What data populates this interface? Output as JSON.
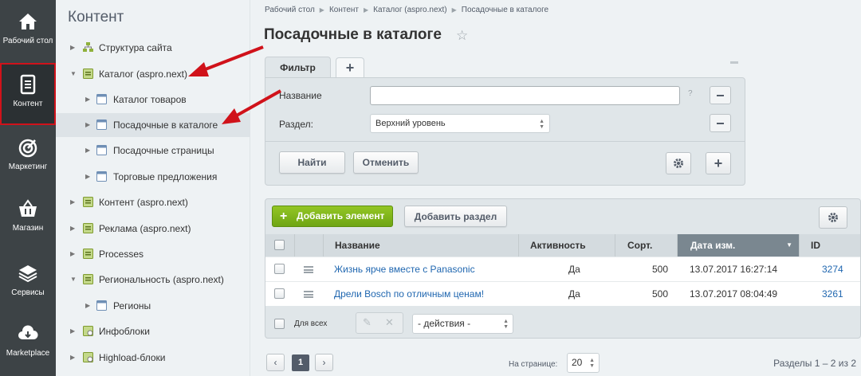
{
  "left_menu": [
    {
      "label": "Рабочий стол",
      "icon": "home-icon"
    },
    {
      "label": "Контент",
      "icon": "document-icon"
    },
    {
      "label": "Маркетинг",
      "icon": "target-icon"
    },
    {
      "label": "Магазин",
      "icon": "basket-icon"
    },
    {
      "label": "Сервисы",
      "icon": "layers-icon"
    },
    {
      "label": "Marketplace",
      "icon": "cloud-download-icon"
    }
  ],
  "tree": {
    "title": "Контент",
    "items": [
      {
        "label": "Структура сайта"
      },
      {
        "label": "Каталог (aspro.next)"
      },
      {
        "label": "Каталог товаров"
      },
      {
        "label": "Посадочные в каталоге"
      },
      {
        "label": "Посадочные страницы"
      },
      {
        "label": "Торговые предложения"
      },
      {
        "label": "Контент (aspro.next)"
      },
      {
        "label": "Реклама (aspro.next)"
      },
      {
        "label": "Processes"
      },
      {
        "label": "Региональность (aspro.next)"
      },
      {
        "label": "Регионы"
      },
      {
        "label": "Инфоблоки"
      },
      {
        "label": "Highload-блоки"
      }
    ]
  },
  "breadcrumbs": [
    "Рабочий стол",
    "Контент",
    "Каталог (aspro.next)",
    "Посадочные в каталоге"
  ],
  "page_title": "Посадочные в каталоге",
  "filter": {
    "tab_label": "Фильтр",
    "add_tab": "+",
    "name_label": "Название",
    "name_value": "",
    "help": "?",
    "section_label": "Раздел:",
    "section_value": "Верхний уровень",
    "find_button": "Найти",
    "cancel_button": "Отменить",
    "add_field": "+"
  },
  "list": {
    "add_element": "Добавить элемент",
    "add_section": "Добавить раздел",
    "columns": [
      "Название",
      "Активность",
      "Сорт.",
      "Дата изм.",
      "ID"
    ],
    "rows": [
      {
        "name": "Жизнь ярче вместе с Panasonic",
        "active": "Да",
        "sort": "500",
        "date": "13.07.2017 16:27:14",
        "id": "3274"
      },
      {
        "name": "Дрели Bosch по отличным ценам!",
        "active": "Да",
        "sort": "500",
        "date": "13.07.2017 08:04:49",
        "id": "3261"
      }
    ],
    "for_all": "Для всех",
    "actions_placeholder": "- действия -"
  },
  "pager": {
    "prev": "‹",
    "current": "1",
    "next": "›",
    "per_page_label": "На странице:",
    "per_page": "20",
    "summary": "Разделы 1 – 2 из 2"
  },
  "colors": {
    "accent_green": "#7ab51d",
    "annotation_red": "#d0121a",
    "menu_dark": "#3d4346",
    "link_blue": "#2067b0"
  }
}
